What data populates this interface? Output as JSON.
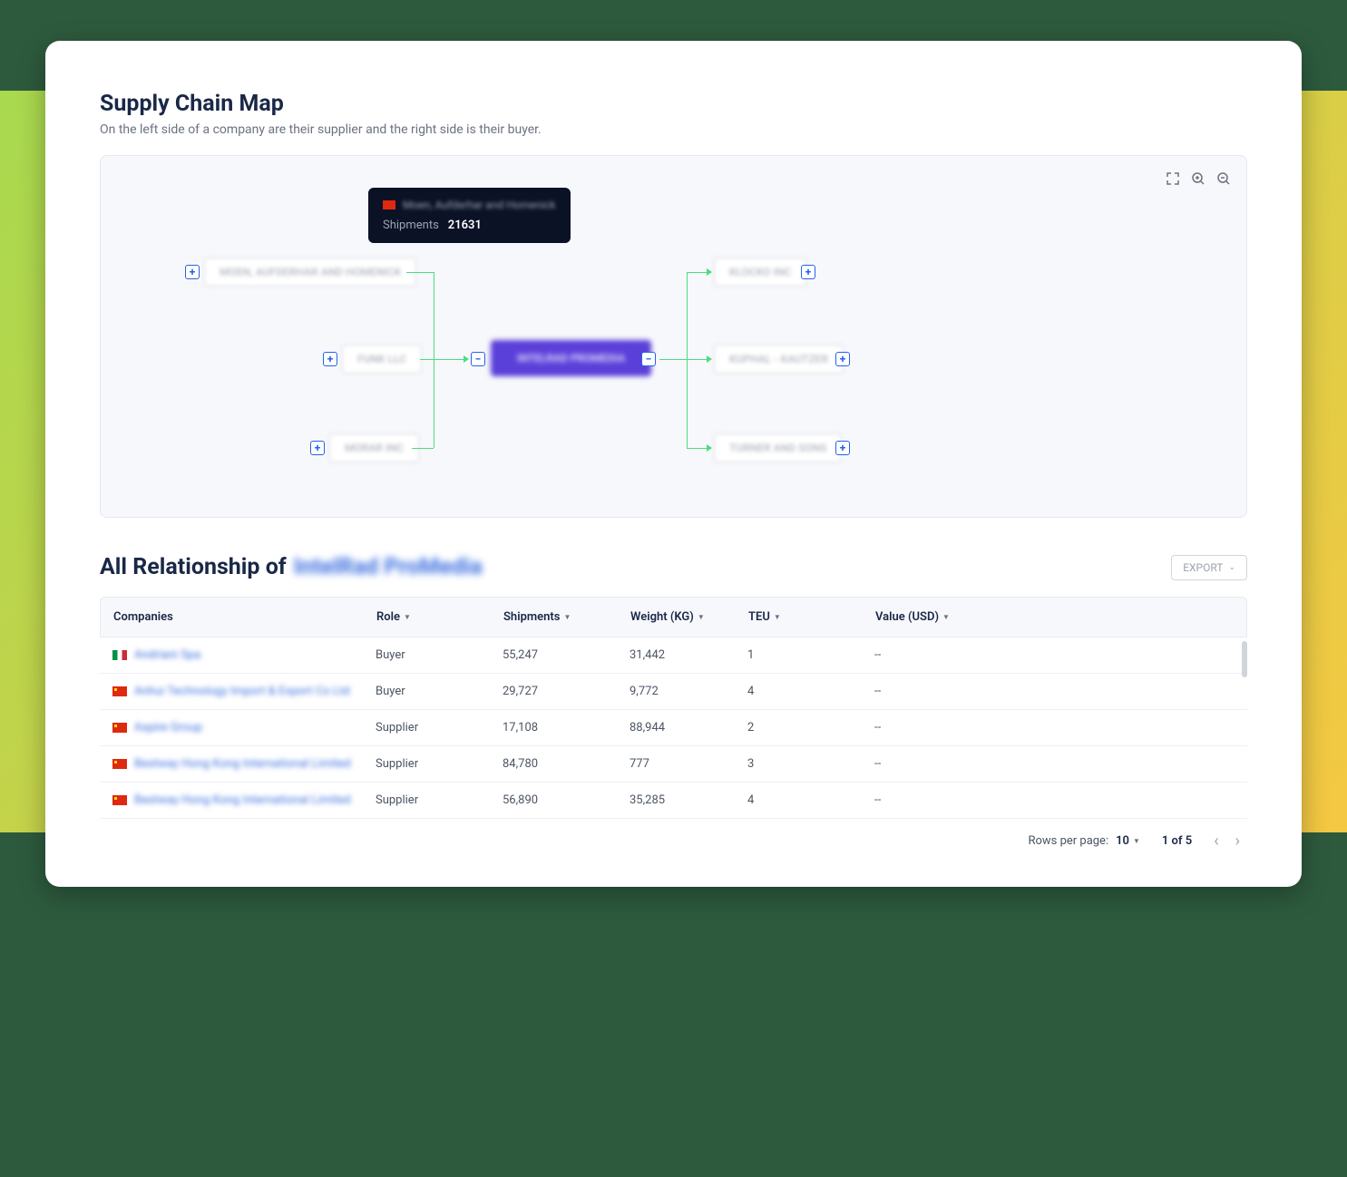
{
  "map": {
    "title": "Supply Chain Map",
    "subtitle": "On the left side of a company are their supplier and the right side is their buyer.",
    "tooltip": {
      "name": "Moen, Aufderhar and Homenick",
      "shipments_label": "Shipments",
      "shipments_value": "21631"
    },
    "nodes": {
      "supplier1": "MOEN, AUFDERHAR AND HOMENICK",
      "supplier2": "FUNK LLC",
      "supplier3": "MORAR INC",
      "center": "INTELRAD PROMEDIA",
      "buyer1": "KLOCKO INC",
      "buyer2": "KUPHAL - KAUTZER",
      "buyer3": "TURNER AND SONS"
    }
  },
  "relationships": {
    "title_prefix": "All Relationship of",
    "company": "IntelRad ProMedia",
    "export_label": "EXPORT",
    "columns": {
      "companies": "Companies",
      "role": "Role",
      "shipments": "Shipments",
      "weight": "Weight (KG)",
      "teu": "TEU",
      "value": "Value (USD)"
    },
    "rows": [
      {
        "flag": "it",
        "name": "Andriani Spa",
        "role": "Buyer",
        "shipments": "55,247",
        "weight": "31,442",
        "teu": "1",
        "value": "--"
      },
      {
        "flag": "cn",
        "name": "Anhui Technology Import & Export Co Ltd",
        "role": "Buyer",
        "shipments": "29,727",
        "weight": "9,772",
        "teu": "4",
        "value": "--"
      },
      {
        "flag": "cn",
        "name": "Aspire Group",
        "role": "Supplier",
        "shipments": "17,108",
        "weight": "88,944",
        "teu": "2",
        "value": "--"
      },
      {
        "flag": "cn",
        "name": "Bestway Hong Kong International Limited",
        "role": "Supplier",
        "shipments": "84,780",
        "weight": "777",
        "teu": "3",
        "value": "--"
      },
      {
        "flag": "cn",
        "name": "Bestway Hong Kong International Limited",
        "role": "Supplier",
        "shipments": "56,890",
        "weight": "35,285",
        "teu": "4",
        "value": "--"
      }
    ],
    "pagination": {
      "rows_label": "Rows per page:",
      "rows_value": "10",
      "page_info": "1 of 5"
    }
  }
}
